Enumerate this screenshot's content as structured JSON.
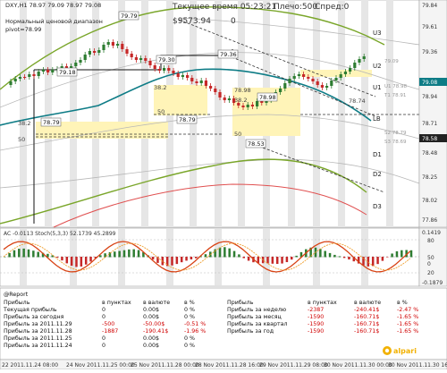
{
  "chart_header": {
    "symbol_line": "DXY,H1  78.97 79.09 78.97 79.08",
    "corridor_line": "Нормальный ценовой диапазон",
    "pivot_line": "pivot=78.99",
    "server_time": "Текущее время 05:23:21",
    "float_text": "Плечо:500",
    "spread_text": "Спред:0",
    "balance_text": "$9573.94",
    "zero_text": "0"
  },
  "price_axis": {
    "ticks": [
      "79.84",
      "79.61",
      "79.36",
      "79.08",
      "78.94",
      "78.71",
      "78.48",
      "78.25",
      "78.02",
      "77.86"
    ],
    "current_price": "79.08",
    "extra_price": "78.58"
  },
  "levels": {
    "right_labels": [
      "U3",
      "U2",
      "U1",
      "LB",
      "D1",
      "D2",
      "D3"
    ],
    "price_tags": [
      {
        "name": "tag-79-79",
        "text": "79.79"
      },
      {
        "name": "tag-79-18",
        "text": "79.18"
      },
      {
        "name": "tag-79-30",
        "text": "79.30"
      },
      {
        "name": "tag-79-36",
        "text": "79.36"
      },
      {
        "name": "tag-78-98",
        "text": "78.98"
      },
      {
        "name": "tag-78-79a",
        "text": "78.79"
      },
      {
        "name": "tag-78-79b",
        "text": "78.79"
      },
      {
        "name": "tag-78-53",
        "text": "78.53"
      }
    ],
    "fib_labels": [
      "38.2",
      "50",
      "38.2",
      "50",
      "78.98",
      "38.2",
      "50",
      "78.74"
    ],
    "faint_right_labels": [
      "79.09",
      "U1 78.98",
      "T1 78.91",
      "S2 78.79",
      "S3 78.69"
    ]
  },
  "indicator": {
    "title": "AC -0.0113  Stoch(5,3,3) 52.1739 45.2899",
    "ticks": [
      "0.1419",
      "80",
      "50",
      "20",
      "0",
      "-0.1879"
    ]
  },
  "report": {
    "title": "@Report",
    "col_headers": [
      "в пунктах",
      "в валюте",
      "в %"
    ],
    "left_rows": [
      {
        "label": "Прибыль",
        "points": "",
        "money": "",
        "pct": "",
        "red": false
      },
      {
        "label": "Текущая прибыль",
        "points": "0",
        "money": "0.00$",
        "pct": "0 %",
        "red": false
      },
      {
        "label": "Прибыль за сегодня",
        "points": "0",
        "money": "0.00$",
        "pct": "0 %",
        "red": false
      },
      {
        "label": "Прибыль за 2011.11.29",
        "points": "-500",
        "money": "-50.00$",
        "pct": "-0.51 %",
        "red": true
      },
      {
        "label": "Прибыль за 2011.11.28",
        "points": "-1887",
        "money": "-190.41$",
        "pct": "-1.96 %",
        "red": true
      },
      {
        "label": "Прибыль за 2011.11.25",
        "points": "0",
        "money": "0.00$",
        "pct": "0 %",
        "red": false
      },
      {
        "label": "Прибыль за 2011.11.24",
        "points": "0",
        "money": "0.00$",
        "pct": "0 %",
        "red": false
      }
    ],
    "right_rows": [
      {
        "label": "Прибыль",
        "points": "",
        "money": "",
        "pct": "",
        "red": false
      },
      {
        "label": "Прибыль за неделю",
        "points": "-2387",
        "money": "-240.41$",
        "pct": "-2.47 %",
        "red": true
      },
      {
        "label": "Прибыль за месяц",
        "points": "-1590",
        "money": "-160.71$",
        "pct": "-1.65 %",
        "red": true
      },
      {
        "label": "Прибыль за квартал",
        "points": "-1590",
        "money": "-160.71$",
        "pct": "-1.65 %",
        "red": true
      },
      {
        "label": "Прибыль за год",
        "points": "-1590",
        "money": "-160.71$",
        "pct": "-1.65 %",
        "red": true
      }
    ]
  },
  "time_axis": [
    "22 2011.11.24 08:00",
    "24 Nov 2011.11.25 00:00",
    "25 Nov 2011.11.28 00:00",
    "28 Nov 2011.11.28 16:00",
    "29 Nov 2011.11.29 08:00",
    "30 Nov 2011.11.30 00:00",
    "30 Nov 2011.11.30 16:00"
  ],
  "brand": "alpari",
  "colors": {
    "up": "#2e7d32",
    "down": "#c62828",
    "teal": "#0e7c86",
    "ma_green": "#7aa62a",
    "band_yellow": "#fff4b8"
  }
}
